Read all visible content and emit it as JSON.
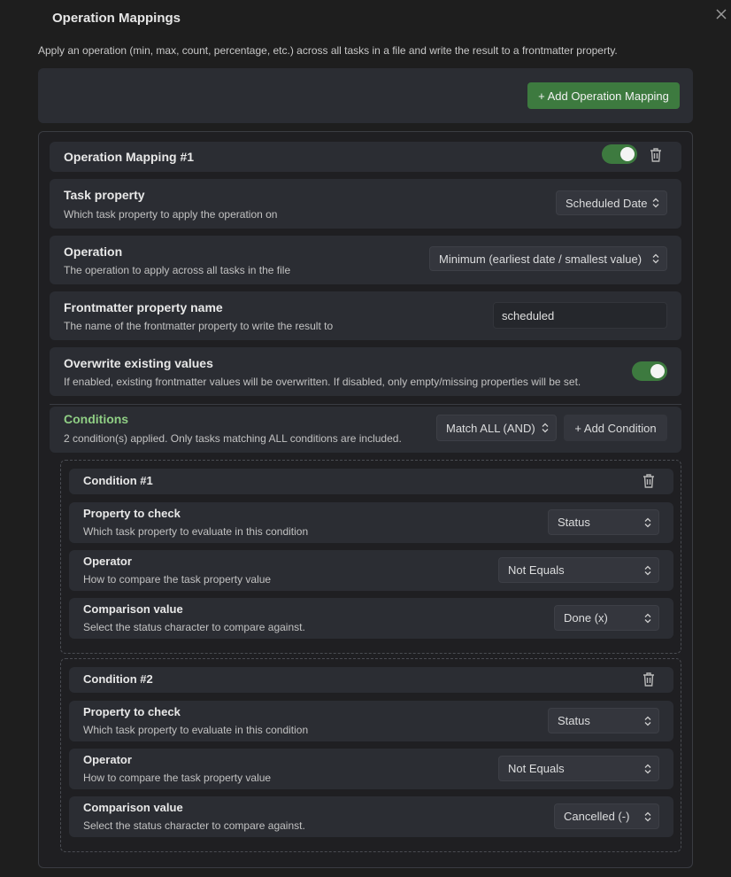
{
  "modal": {
    "title": "Operation Mappings",
    "description": "Apply an operation (min, max, count, percentage, etc.) across all tasks in a file and write the result to a frontmatter property.",
    "close_icon": "close-icon"
  },
  "toolbar": {
    "add_mapping_label": "+ Add Operation Mapping"
  },
  "mapping": {
    "title": "Operation Mapping #1",
    "enabled": true,
    "task_property": {
      "label": "Task property",
      "desc": "Which task property to apply the operation on",
      "value": "Scheduled Date"
    },
    "operation": {
      "label": "Operation",
      "desc": "The operation to apply across all tasks in the file",
      "value": "Minimum (earliest date / smallest value)"
    },
    "frontmatter": {
      "label": "Frontmatter property name",
      "desc": "The name of the frontmatter property to write the result to",
      "value": "scheduled"
    },
    "overwrite": {
      "label": "Overwrite existing values",
      "desc": "If enabled, existing frontmatter values will be overwritten. If disabled, only empty/missing properties will be set.",
      "enabled": true
    },
    "conditions": {
      "label": "Conditions",
      "desc": "2 condition(s) applied. Only tasks matching ALL conditions are included.",
      "match_mode": "Match ALL (AND)",
      "add_label": "+ Add Condition",
      "items": [
        {
          "title": "Condition #1",
          "property": {
            "label": "Property to check",
            "desc": "Which task property to evaluate in this condition",
            "value": "Status"
          },
          "operator": {
            "label": "Operator",
            "desc": "How to compare the task property value",
            "value": "Not Equals"
          },
          "comparison": {
            "label": "Comparison value",
            "desc": "Select the status character to compare against.",
            "value": "Done (x)"
          }
        },
        {
          "title": "Condition #2",
          "property": {
            "label": "Property to check",
            "desc": "Which task property to evaluate in this condition",
            "value": "Status"
          },
          "operator": {
            "label": "Operator",
            "desc": "How to compare the task property value",
            "value": "Not Equals"
          },
          "comparison": {
            "label": "Comparison value",
            "desc": "Select the status character to compare against.",
            "value": "Cancelled (-)"
          }
        }
      ]
    }
  },
  "colors": {
    "accent_green": "#3d7a3f",
    "conditions_title": "#8fce84",
    "background": "#1e1e1e",
    "panel": "#2b2d33"
  }
}
